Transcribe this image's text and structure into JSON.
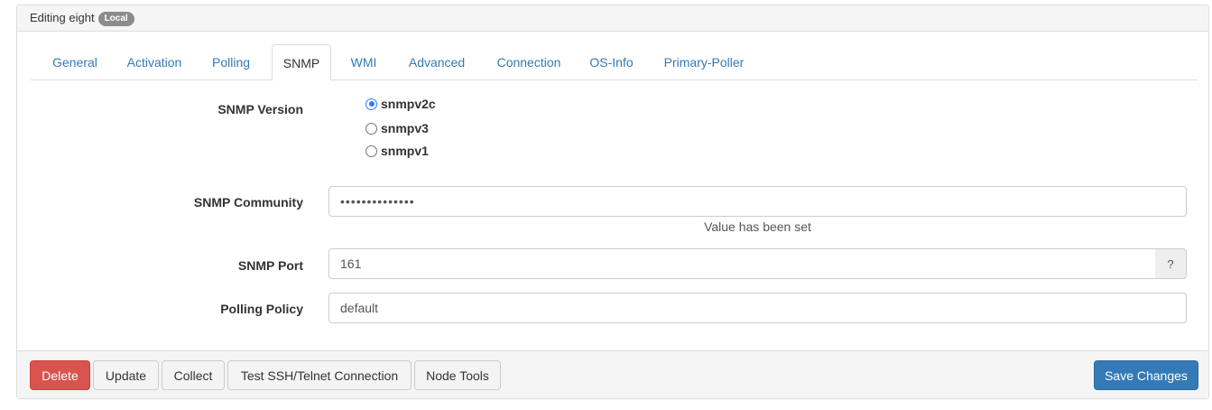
{
  "header": {
    "title": "Editing eight",
    "badge": "Local"
  },
  "tabs": [
    {
      "label": "General",
      "active": false
    },
    {
      "label": "Activation",
      "active": false
    },
    {
      "label": "Polling",
      "active": false
    },
    {
      "label": "SNMP",
      "active": true
    },
    {
      "label": "WMI",
      "active": false
    },
    {
      "label": "Advanced",
      "active": false
    },
    {
      "label": "Connection",
      "active": false
    },
    {
      "label": "OS-Info",
      "active": false
    },
    {
      "label": "Primary-Poller",
      "active": false
    }
  ],
  "form": {
    "snmp_version": {
      "label": "SNMP Version",
      "options": [
        {
          "label": "snmpv2c",
          "checked": true
        },
        {
          "label": "snmpv3",
          "checked": false
        },
        {
          "label": "snmpv1",
          "checked": false
        }
      ]
    },
    "snmp_community": {
      "label": "SNMP Community",
      "value": "••••••••••••••",
      "help": "Value has been set"
    },
    "snmp_port": {
      "label": "SNMP Port",
      "value": "161",
      "addon": "?"
    },
    "polling_policy": {
      "label": "Polling Policy",
      "value": "default"
    }
  },
  "footer": {
    "delete": "Delete",
    "update": "Update",
    "collect": "Collect",
    "test_connection": "Test SSH/Telnet Connection",
    "node_tools": "Node Tools",
    "save": "Save Changes"
  },
  "colors": {
    "link": "#337ab7",
    "danger": "#d9534f",
    "primary": "#337ab7",
    "radio_checked": "#3478f6"
  }
}
